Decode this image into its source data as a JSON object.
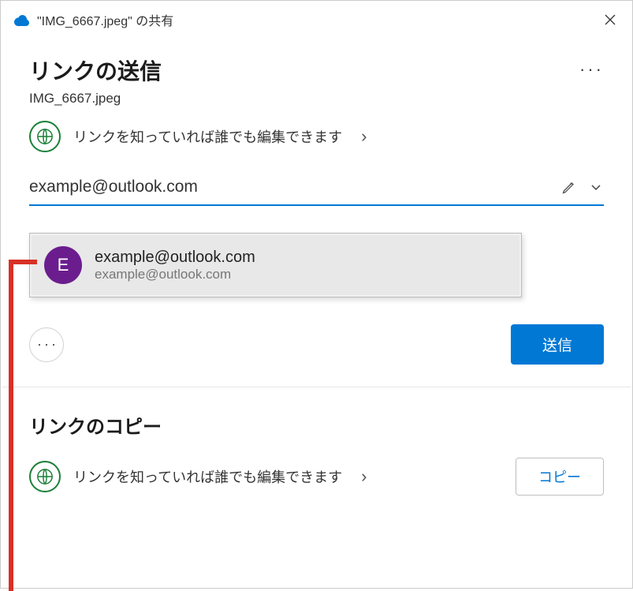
{
  "titlebar": {
    "title": "\"IMG_6667.jpeg\" の共有"
  },
  "header": {
    "title": "リンクの送信",
    "filename": "IMG_6667.jpeg"
  },
  "permission": {
    "text": "リンクを知っていれば誰でも編集できます",
    "chevron": "›"
  },
  "input": {
    "value": "example@outlook.com"
  },
  "suggestion": {
    "avatar_initial": "E",
    "name": "example@outlook.com",
    "email": "example@outlook.com"
  },
  "actions": {
    "send_label": "送信"
  },
  "copy_section": {
    "title": "リンクのコピー",
    "permission_text": "リンクを知っていれば誰でも編集できます",
    "chevron": "›",
    "copy_label": "コピー"
  },
  "colors": {
    "accent": "#0078d4",
    "globe_green": "#1a7f37",
    "avatar_bg": "#6b1d8e",
    "annotation_red": "#d93025"
  }
}
